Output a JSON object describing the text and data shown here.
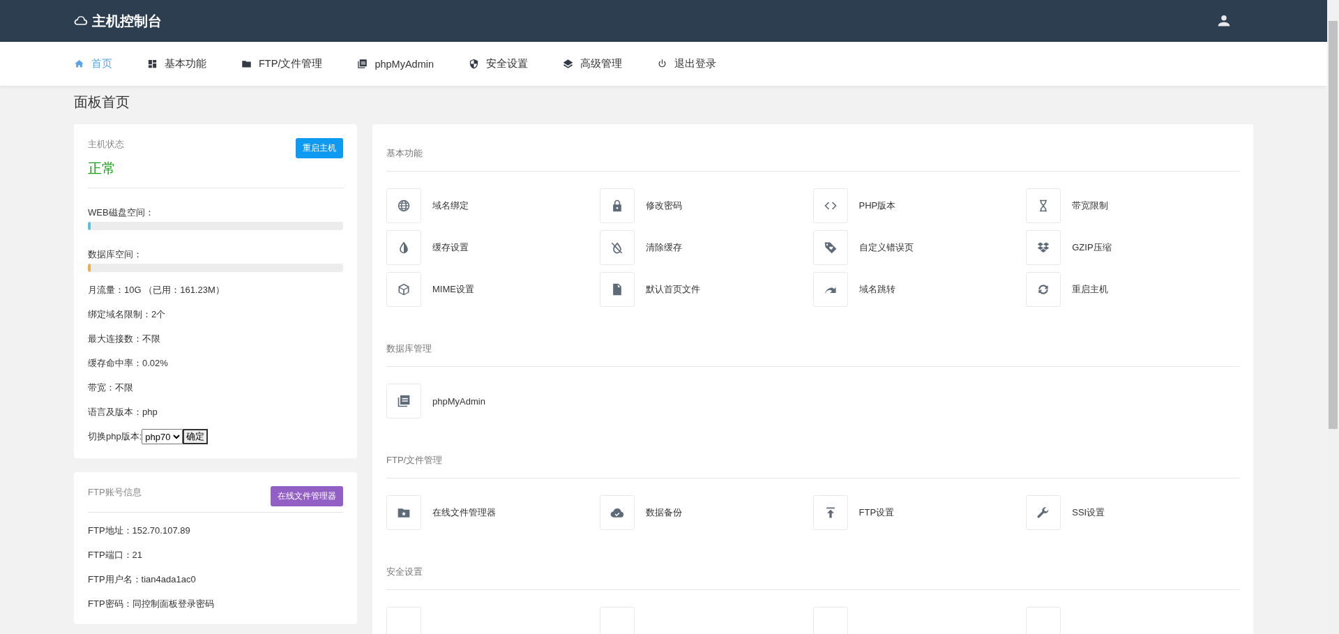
{
  "header": {
    "title": "主机控制台"
  },
  "nav": [
    {
      "label": "首页",
      "selected": true
    },
    {
      "label": "基本功能",
      "selected": false
    },
    {
      "label": "FTP/文件管理",
      "selected": false
    },
    {
      "label": "phpMyAdmin",
      "selected": false
    },
    {
      "label": "安全设置",
      "selected": false
    },
    {
      "label": "高级管理",
      "selected": false
    },
    {
      "label": "退出登录",
      "selected": false
    }
  ],
  "page_title": "面板首页",
  "host_status": {
    "title": "主机状态",
    "status": "正常",
    "restart_button": "重启主机",
    "meters": [
      {
        "label": "WEB磁盘空间：",
        "level": 0.01,
        "color": "#5bc0de"
      },
      {
        "label": "数据库空间：",
        "level": 0.01,
        "color": "#f0ad4e"
      }
    ],
    "facts": [
      "月流量：10G （已用：161.23M）",
      "绑定域名限制：2个",
      "最大连接数：不限",
      "缓存命中率：0.02%",
      "带宽：不限",
      "语言及版本：php"
    ],
    "php_switch": {
      "label": "切换php版本:",
      "value": "php70",
      "button": "确定"
    }
  },
  "ftp_info": {
    "title": "FTP账号信息",
    "button": "在线文件管理器",
    "facts": [
      "FTP地址：152.70.107.89",
      "FTP端口：21",
      "FTP用户名：tian4ada1ac0",
      "FTP密码：同控制面板登录密码"
    ]
  },
  "sections": [
    {
      "title": "基本功能",
      "items": [
        {
          "kind": "link",
          "label": "域名绑定"
        },
        {
          "kind": "link",
          "label": "修改密码"
        },
        {
          "kind": "link",
          "label": "PHP版本"
        },
        {
          "kind": "link",
          "label": "带宽限制"
        },
        {
          "kind": "link",
          "label": "缓存设置"
        },
        {
          "kind": "link",
          "label": "清除缓存"
        },
        {
          "kind": "link",
          "label": "自定义错误页"
        },
        {
          "kind": "link",
          "label": "GZIP压缩"
        },
        {
          "kind": "link",
          "label": "MIME设置"
        },
        {
          "kind": "link",
          "label": "默认首页文件"
        },
        {
          "kind": "link",
          "label": "域名跳转"
        },
        {
          "kind": "link",
          "label": "重启主机"
        }
      ]
    },
    {
      "title": "数据库管理",
      "items": [
        {
          "kind": "link",
          "label": "phpMyAdmin"
        }
      ]
    },
    {
      "title": "FTP/文件管理",
      "items": [
        {
          "kind": "link",
          "label": "在线文件管理器"
        },
        {
          "kind": "link",
          "label": "数据备份"
        },
        {
          "kind": "link",
          "label": "FTP设置"
        },
        {
          "kind": "link",
          "label": "SSI设置"
        }
      ]
    },
    {
      "title": "安全设置",
      "items": [
        {
          "kind": "cut"
        },
        {
          "kind": "cut"
        },
        {
          "kind": "cut"
        },
        {
          "kind": "cut"
        }
      ]
    }
  ]
}
